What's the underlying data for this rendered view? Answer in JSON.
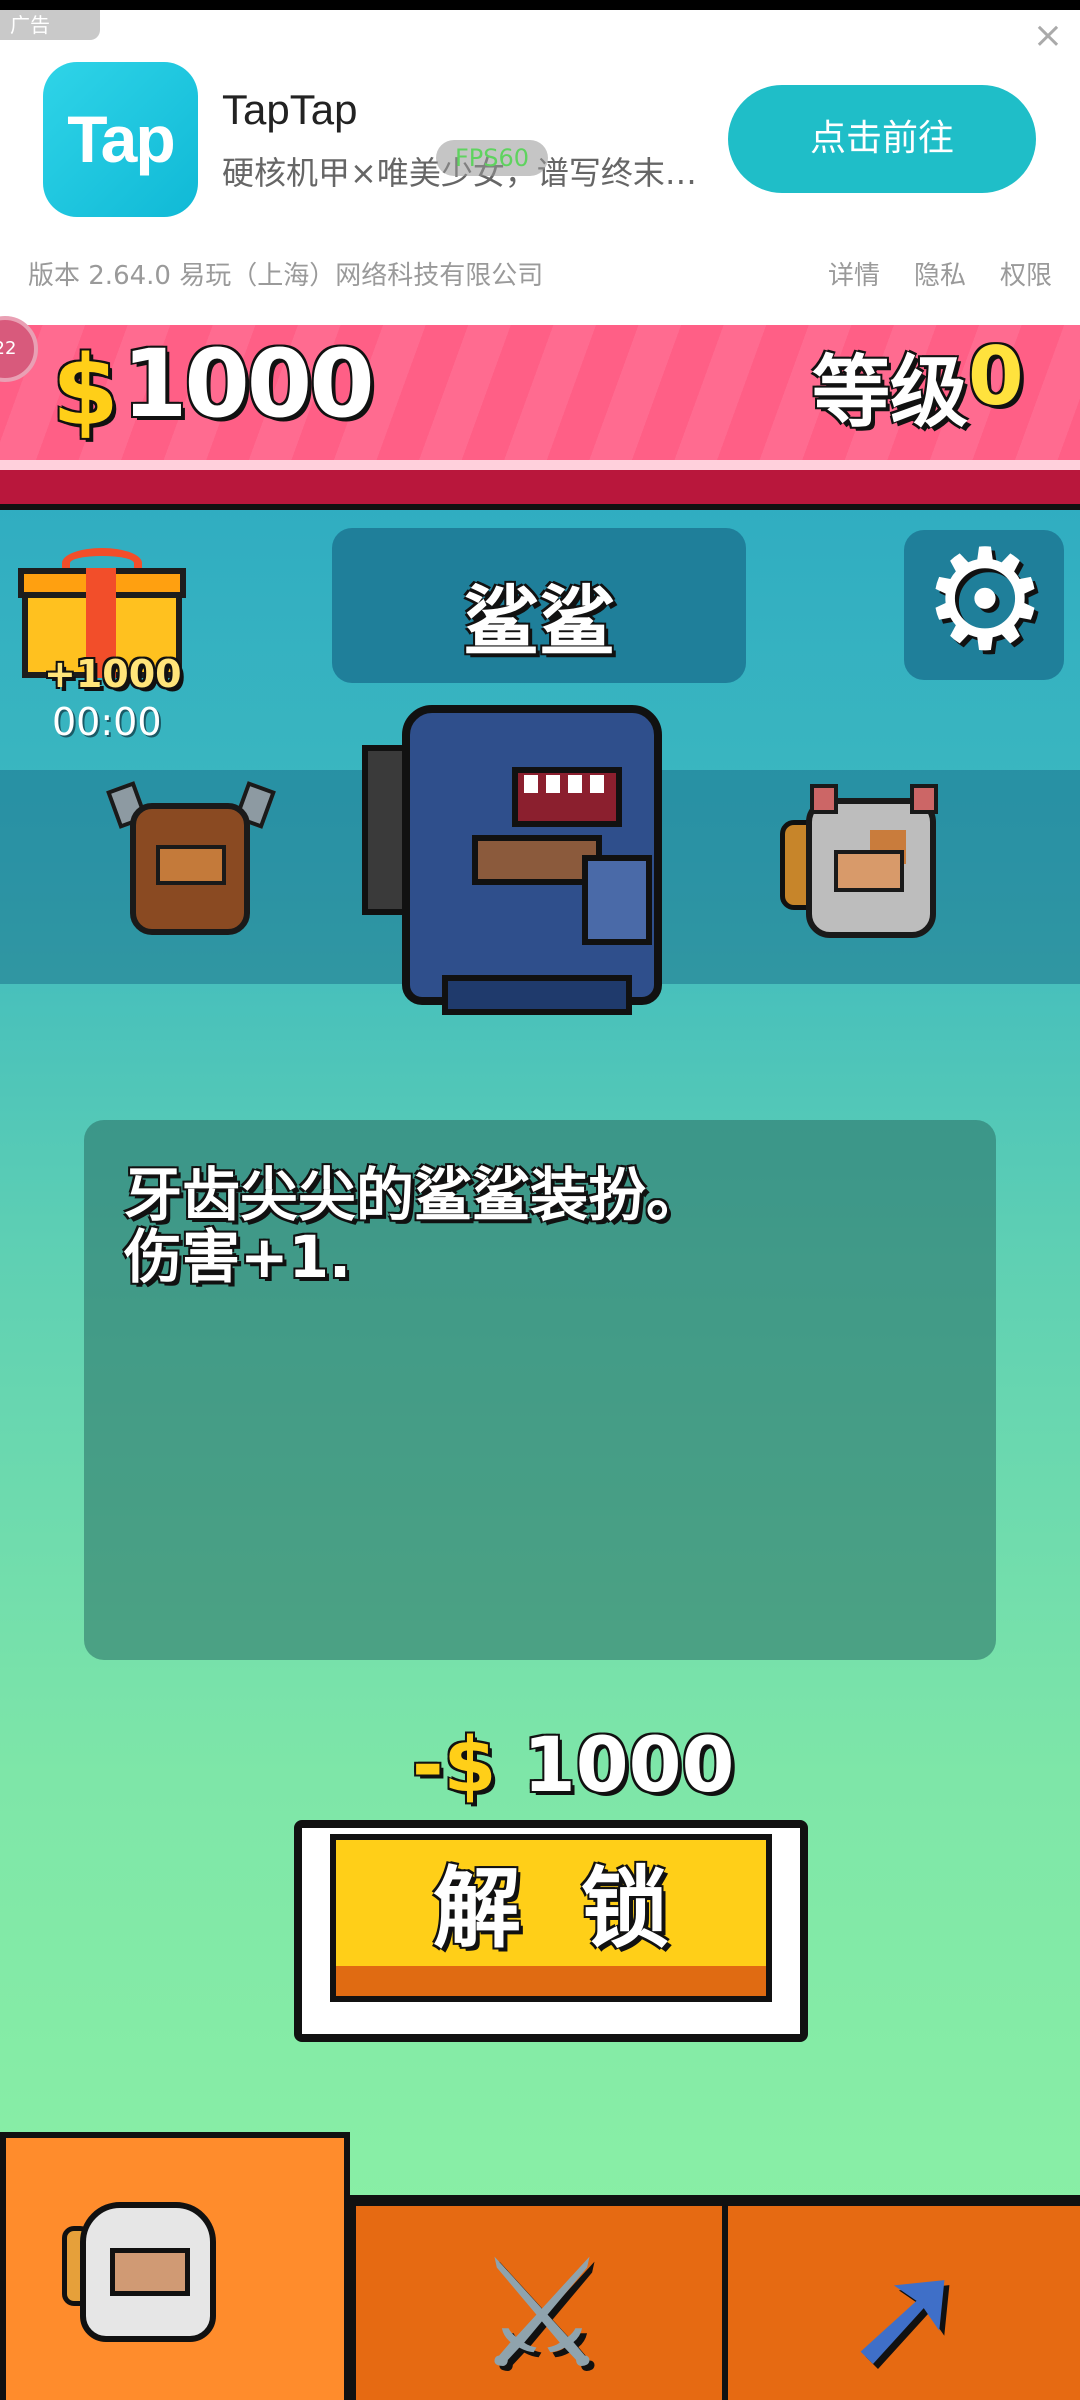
{
  "ad": {
    "tag": "广告",
    "close_icon": "close-icon",
    "logo_text": "Tap",
    "title": "TapTap",
    "description": "硬核机甲×唯美少女，谱写终末…",
    "fps_badge": "FPS60",
    "cta_label": "点击前往",
    "meta": "版本 2.64.0   易玩（上海）网络科技有限公司",
    "links": [
      "详情",
      "隐私",
      "权限"
    ],
    "accent_color": "#1fbec8"
  },
  "hud": {
    "currency_symbol": "$",
    "money": "1000",
    "level_label": "等级",
    "level_value": "0"
  },
  "gift": {
    "amount": "+1000",
    "timer": "00:00"
  },
  "character": {
    "name": "鲨鲨",
    "description_line1": "牙齿尖尖的鲨鲨装扮。",
    "description_line2": "伤害+1."
  },
  "purchase": {
    "price_prefix": "-",
    "currency_symbol": "$",
    "price": "1000",
    "unlock_label": "解锁"
  },
  "tabs": [
    {
      "icon": "character-icon",
      "selected": true
    },
    {
      "icon": "swords-icon",
      "selected": false
    },
    {
      "icon": "arrow-icon",
      "selected": false
    }
  ],
  "colors": {
    "topbar": "#ff5f86",
    "gold": "#ffcf18",
    "tab_active": "#ff8c2c",
    "tab_inactive": "#e66a12"
  }
}
